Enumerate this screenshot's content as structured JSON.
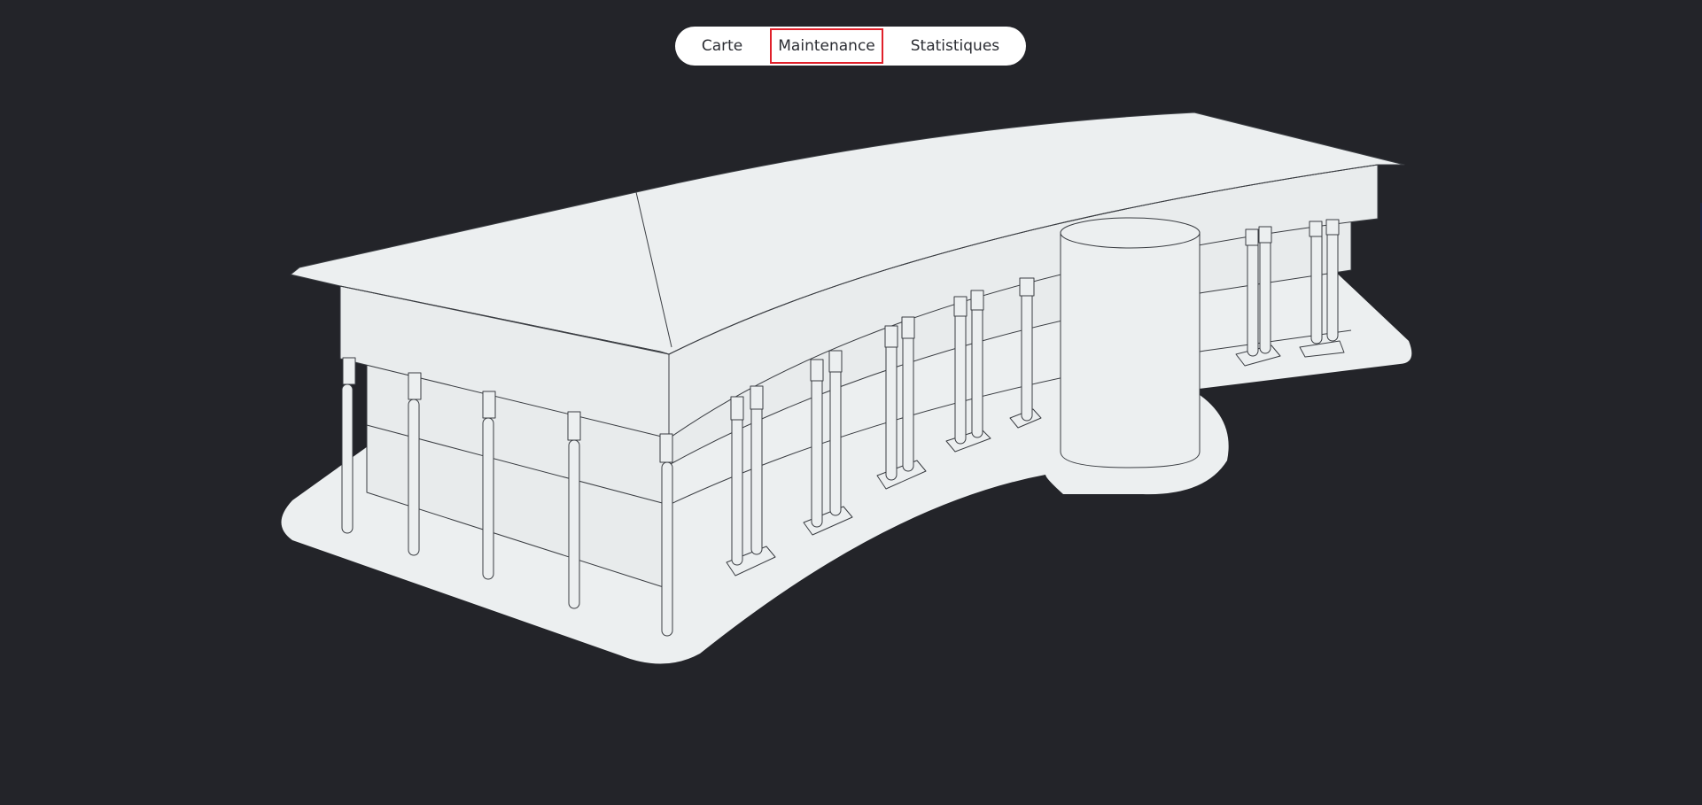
{
  "nav": {
    "items": [
      {
        "label": "Carte",
        "active": false
      },
      {
        "label": "Maintenance",
        "active": true
      },
      {
        "label": "Statistiques",
        "active": false
      }
    ]
  },
  "colors": {
    "background": "#232429",
    "surface": "#eceff0",
    "line": "#3a3d42",
    "nav_bg": "#ffffff",
    "active_outline": "#e0202a"
  },
  "scene": {
    "subject": "building-3d-model"
  }
}
